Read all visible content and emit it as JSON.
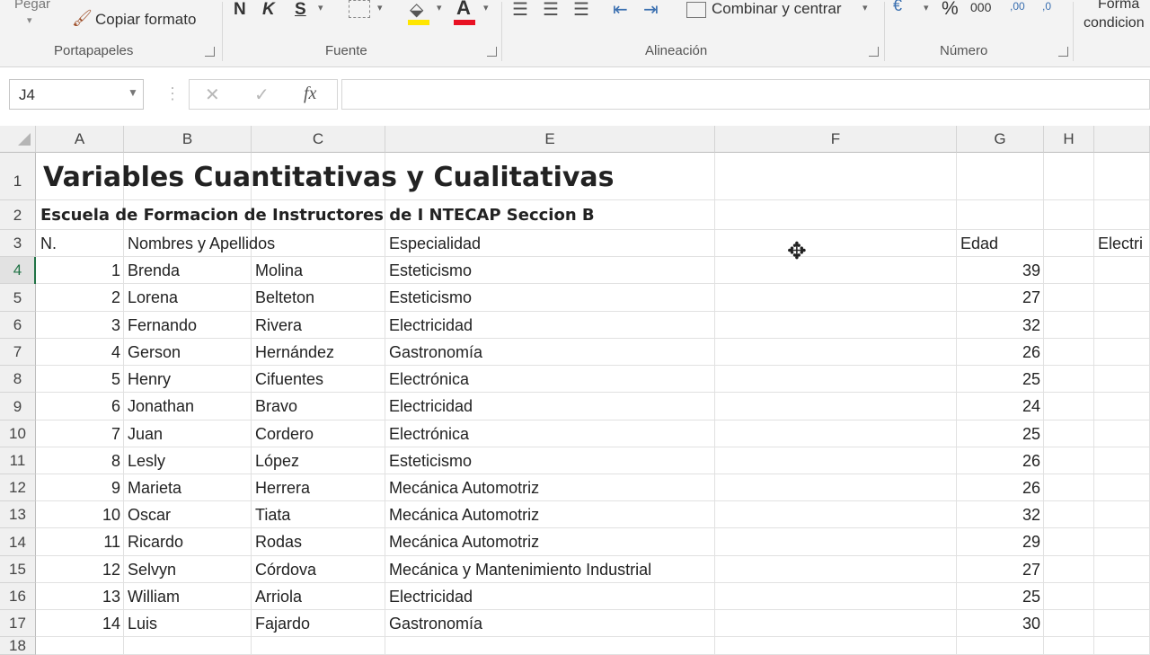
{
  "ribbon": {
    "pegar": "Pegar",
    "copiar_formato": "Copiar formato",
    "bold": "N",
    "italic": "K",
    "underline": "S",
    "font_color_glyph": "A",
    "merge_center": "Combinar y centrar",
    "percent": "%",
    "thousands": "000",
    "dec_increase": ",00",
    "dec_decrease": ",0",
    "conditional_l1": "Forma",
    "conditional_l2": "condicion",
    "groups": {
      "portapapeles": "Portapapeles",
      "fuente": "Fuente",
      "alineacion": "Alineación",
      "numero": "Número"
    },
    "colors": {
      "fill": "#ffe600",
      "font": "#e81123"
    }
  },
  "formula_bar": {
    "name_box": "J4",
    "cancel": "✕",
    "enter": "✓",
    "fx": "fx",
    "content": ""
  },
  "columns": [
    "A",
    "B",
    "C",
    "E",
    "F",
    "G",
    "H"
  ],
  "rows": [
    "1",
    "2",
    "3",
    "4",
    "5",
    "6",
    "7",
    "8",
    "9",
    "10",
    "11",
    "12",
    "13",
    "14",
    "15",
    "16",
    "17",
    "18"
  ],
  "sheet": {
    "title": "Variables Cuantitativas y Cualitativas",
    "subtitle": "Escuela de Formacion de Instructores de I NTECAP Seccion B",
    "headers": {
      "n": "N.",
      "nombres": "Nombres y Apellidos",
      "especialidad": "Especialidad",
      "edad": "Edad",
      "electri": "Electri"
    },
    "data": [
      {
        "n": "1",
        "nombre": "Brenda",
        "apellido": "Molina",
        "especialidad": "Esteticismo",
        "edad": "39"
      },
      {
        "n": "2",
        "nombre": "Lorena",
        "apellido": "Belteton",
        "especialidad": "Esteticismo",
        "edad": "27"
      },
      {
        "n": "3",
        "nombre": "Fernando",
        "apellido": "Rivera",
        "especialidad": "Electricidad",
        "edad": "32"
      },
      {
        "n": "4",
        "nombre": "Gerson",
        "apellido": "Hernández",
        "especialidad": "Gastronomía",
        "edad": "26"
      },
      {
        "n": "5",
        "nombre": "Henry",
        "apellido": "Cifuentes",
        "especialidad": "Electrónica",
        "edad": "25"
      },
      {
        "n": "6",
        "nombre": "Jonathan",
        "apellido": "Bravo",
        "especialidad": "Electricidad",
        "edad": "24"
      },
      {
        "n": "7",
        "nombre": "Juan",
        "apellido": "Cordero",
        "especialidad": "Electrónica",
        "edad": "25"
      },
      {
        "n": "8",
        "nombre": "Lesly",
        "apellido": "López",
        "especialidad": "Esteticismo",
        "edad": "26"
      },
      {
        "n": "9",
        "nombre": "Marieta",
        "apellido": "Herrera",
        "especialidad": "Mecánica Automotriz",
        "edad": "26"
      },
      {
        "n": "10",
        "nombre": "Oscar",
        "apellido": "Tiata",
        "especialidad": "Mecánica Automotriz",
        "edad": "32"
      },
      {
        "n": "11",
        "nombre": "Ricardo",
        "apellido": "Rodas",
        "especialidad": "Mecánica Automotriz",
        "edad": "29"
      },
      {
        "n": "12",
        "nombre": "Selvyn",
        "apellido": "Córdova",
        "especialidad": "Mecánica y Mantenimiento Industrial",
        "edad": "27"
      },
      {
        "n": "13",
        "nombre": "William",
        "apellido": "Arriola",
        "especialidad": "Electricidad",
        "edad": "25"
      },
      {
        "n": "14",
        "nombre": "Luis",
        "apellido": "Fajardo",
        "especialidad": "Gastronomía",
        "edad": "30"
      }
    ]
  }
}
